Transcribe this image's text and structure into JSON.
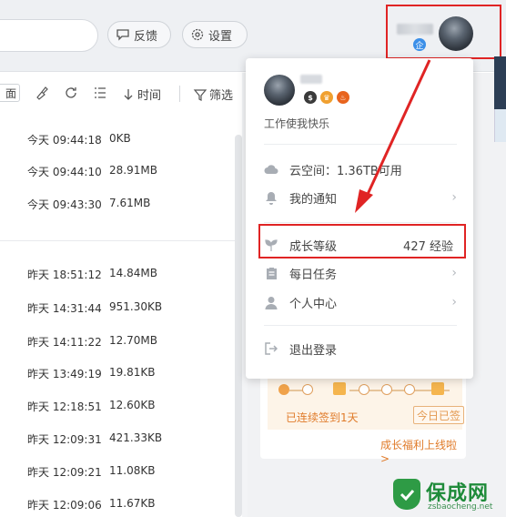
{
  "topbar": {
    "feedback_label": "反馈",
    "settings_label": "设置"
  },
  "toolbar": {
    "view_label": "面",
    "time_label": "时间",
    "filter_label": "筛选"
  },
  "files": [
    {
      "time": "今天 09:44:18",
      "size": "0KB"
    },
    {
      "time": "今天 09:44:10",
      "size": "28.91MB"
    },
    {
      "time": "今天 09:43:30",
      "size": "7.61MB"
    },
    {
      "time": "昨天 18:51:12",
      "size": "14.84MB"
    },
    {
      "time": "昨天 14:31:44",
      "size": "951.30KB"
    },
    {
      "time": "昨天 14:11:22",
      "size": "12.70MB"
    },
    {
      "time": "昨天 13:49:19",
      "size": "19.81KB"
    },
    {
      "time": "昨天 12:18:51",
      "size": "12.60KB"
    },
    {
      "time": "昨天 12:09:31",
      "size": "421.33KB"
    },
    {
      "time": "昨天 12:09:21",
      "size": "11.08KB"
    },
    {
      "time": "昨天 12:09:06",
      "size": "11.67KB"
    }
  ],
  "user_chip": {
    "vip_badge": "企"
  },
  "dropdown": {
    "signature": "工作使我快乐",
    "level_badges": [
      {
        "text": "$",
        "color": "#3a3a3a"
      },
      {
        "text": "♛",
        "color": "#f0a030"
      },
      {
        "text": "♨",
        "color": "#e8641e"
      }
    ],
    "cloud_space": "云空间：1.36TB可用",
    "notifications": "我的通知",
    "growth_level": "成长等级",
    "growth_exp": "427 经验",
    "daily_tasks": "每日任务",
    "personal_center": "个人中心",
    "logout": "退出登录"
  },
  "sign_in": {
    "days_text": "已连续签到1天",
    "signed_button": "今日已签",
    "benefit_link": "成长福利上线啦>"
  },
  "watermark": {
    "title": "保成网",
    "url": "zsbaocheng.net"
  },
  "colors": {
    "highlight": "#e02424",
    "accent_orange": "#e07b2a",
    "vip_blue": "#3b8fe8"
  }
}
